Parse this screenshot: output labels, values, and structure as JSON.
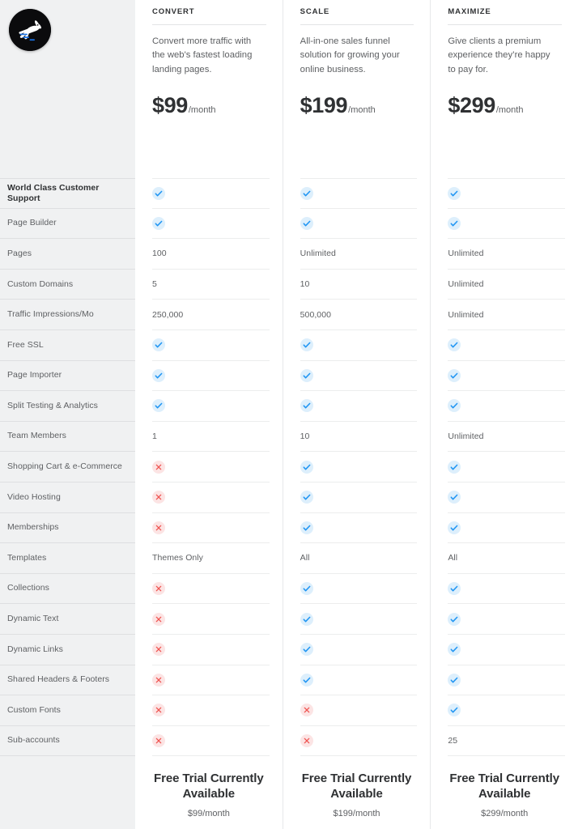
{
  "brand": {
    "logo_icon": "running-rabbit-logo",
    "logo_bg": "#0b0b0d",
    "accent_blue": "#2196f3",
    "accent_red": "#ef5350"
  },
  "colors": {
    "sidebar_bg": "#f0f1f2",
    "content_bg": "#ffffff",
    "row_divider": "#eceded",
    "check_bg": "#ddeffc",
    "cross_bg": "#fce4e4",
    "text_primary": "#2f3133",
    "text_secondary": "#5e6063"
  },
  "features": [
    {
      "label": "World Class Customer Support",
      "emphasis": true
    },
    {
      "label": "Page Builder",
      "emphasis": false
    },
    {
      "label": "Pages",
      "emphasis": false
    },
    {
      "label": "Custom Domains",
      "emphasis": false
    },
    {
      "label": "Traffic Impressions/Mo",
      "emphasis": false
    },
    {
      "label": "Free SSL",
      "emphasis": false
    },
    {
      "label": "Page Importer",
      "emphasis": false
    },
    {
      "label": "Split Testing & Analytics",
      "emphasis": false
    },
    {
      "label": "Team Members",
      "emphasis": false
    },
    {
      "label": "Shopping Cart & e-Commerce",
      "emphasis": false
    },
    {
      "label": "Video Hosting",
      "emphasis": false
    },
    {
      "label": "Memberships",
      "emphasis": false
    },
    {
      "label": "Templates",
      "emphasis": false
    },
    {
      "label": "Collections",
      "emphasis": false
    },
    {
      "label": "Dynamic Text",
      "emphasis": false
    },
    {
      "label": "Dynamic Links",
      "emphasis": false
    },
    {
      "label": "Shared Headers & Footers",
      "emphasis": false
    },
    {
      "label": "Custom Fonts",
      "emphasis": false
    },
    {
      "label": "Sub-accounts",
      "emphasis": false
    }
  ],
  "plans": [
    {
      "name": "CONVERT",
      "description": "Convert more traffic with the web's fastest loading landing pages.",
      "price_amount": "$99",
      "price_period": "/month",
      "cta_title": "Free Trial Currently Available",
      "cta_subtitle": "$99/month",
      "values": [
        "check",
        "check",
        "100",
        "5",
        "250,000",
        "check",
        "check",
        "check",
        "1",
        "cross",
        "cross",
        "cross",
        "Themes Only",
        "cross",
        "cross",
        "cross",
        "cross",
        "cross",
        "cross"
      ]
    },
    {
      "name": "SCALE",
      "description": "All-in-one sales funnel solution for growing your online business.",
      "price_amount": "$199",
      "price_period": "/month",
      "cta_title": "Free Trial Currently Available",
      "cta_subtitle": "$199/month",
      "values": [
        "check",
        "check",
        "Unlimited",
        "10",
        "500,000",
        "check",
        "check",
        "check",
        "10",
        "check",
        "check",
        "check",
        "All",
        "check",
        "check",
        "check",
        "check",
        "cross",
        "cross"
      ]
    },
    {
      "name": "MAXIMIZE",
      "description": "Give clients a premium experience they’re happy to pay for.",
      "price_amount": "$299",
      "price_period": "/month",
      "cta_title": "Free Trial Currently Available",
      "cta_subtitle": "$299/month",
      "values": [
        "check",
        "check",
        "Unlimited",
        "Unlimited",
        "Unlimited",
        "check",
        "check",
        "check",
        "Unlimited",
        "check",
        "check",
        "check",
        "All",
        "check",
        "check",
        "check",
        "check",
        "check",
        "25"
      ]
    }
  ]
}
